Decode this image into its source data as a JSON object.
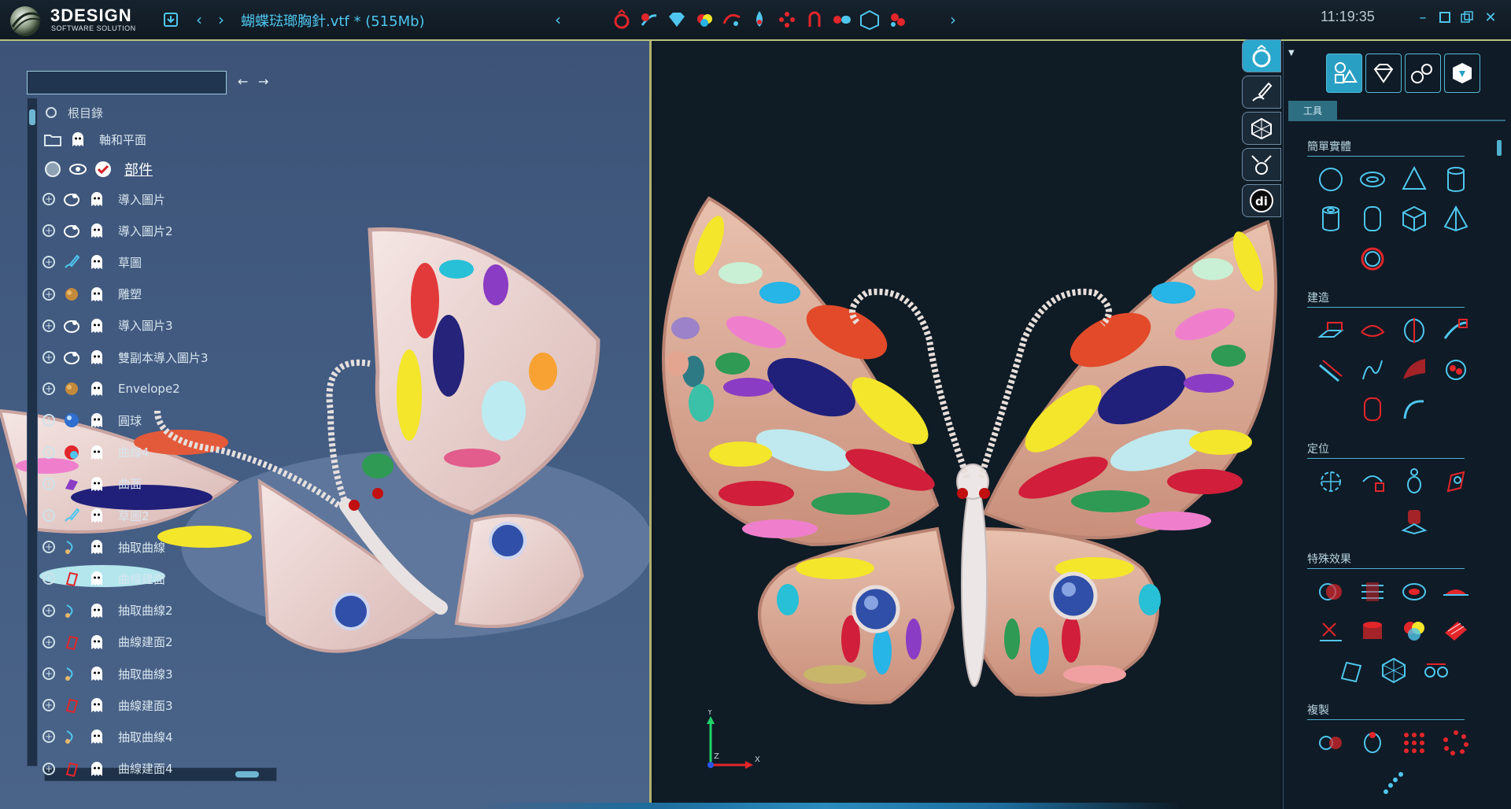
{
  "app": {
    "brand": "3DESIGN",
    "brand_sub": "SOFTWARE SOLUTION",
    "file_title": "蝴蝶琺瑯胸針.vtf *  (515Mb)",
    "clock": "11:19:35"
  },
  "mode_icons": [
    "ring-icon",
    "shank-icon",
    "gem-icon",
    "color-icon",
    "curve-icon",
    "drop-icon",
    "bead-icon",
    "bail-icon",
    "link-icon",
    "cube-icon",
    "cluster-icon"
  ],
  "tree": {
    "search_value": "",
    "root_label": "根目錄",
    "axes_label": "軸和平面",
    "parts_label": "部件",
    "items": [
      {
        "label": "導入圖片",
        "icon": "image-import-icon"
      },
      {
        "label": "導入圖片2",
        "icon": "image-import-icon"
      },
      {
        "label": "草圖",
        "icon": "sketch-icon"
      },
      {
        "label": "雕塑",
        "icon": "sculpt-icon"
      },
      {
        "label": "導入圖片3",
        "icon": "image-import-icon"
      },
      {
        "label": "雙副本導入圖片3",
        "icon": "image-import-icon"
      },
      {
        "label": "Envelope2",
        "icon": "sculpt-icon"
      },
      {
        "label": "圓球",
        "icon": "sphere-icon"
      },
      {
        "label": "曲線4",
        "icon": "color-sphere-icon"
      },
      {
        "label": "曲面",
        "icon": "surface-icon"
      },
      {
        "label": "草圖2",
        "icon": "sketch-icon"
      },
      {
        "label": "抽取曲線",
        "icon": "extract-curve-icon"
      },
      {
        "label": "曲線建面",
        "icon": "curve-surface-icon"
      },
      {
        "label": "抽取曲線2",
        "icon": "extract-curve-icon"
      },
      {
        "label": "曲線建面2",
        "icon": "curve-surface-icon"
      },
      {
        "label": "抽取曲線3",
        "icon": "extract-curve-icon"
      },
      {
        "label": "曲線建面3",
        "icon": "curve-surface-icon"
      },
      {
        "label": "抽取曲線4",
        "icon": "extract-curve-icon"
      },
      {
        "label": "曲線建面4",
        "icon": "curve-surface-icon"
      }
    ]
  },
  "axis": {
    "y": "Y",
    "x": "X",
    "z": "Z"
  },
  "panel": {
    "tab_label": "工具",
    "sections": [
      {
        "title": "簡單實體"
      },
      {
        "title": "建造"
      },
      {
        "title": "定位"
      },
      {
        "title": "特殊效果"
      },
      {
        "title": "複製"
      }
    ]
  },
  "colors": {
    "accent": "#4fc6ee",
    "left_bg": "#435c82",
    "right_bg": "#0f1c26",
    "panel_bg": "#0f1b26"
  }
}
